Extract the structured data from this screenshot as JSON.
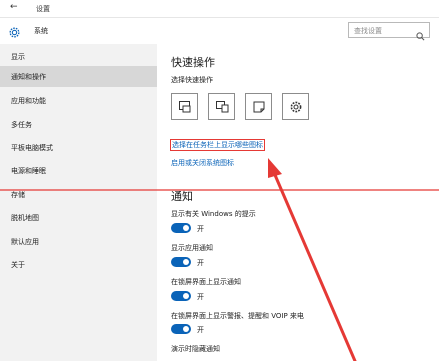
{
  "window": {
    "title": "设置"
  },
  "header": {
    "title": "系统",
    "search_placeholder": "查找设置"
  },
  "sidebar": {
    "items": [
      {
        "label": "显示"
      },
      {
        "label": "通知和操作",
        "active": true
      },
      {
        "label": "应用和功能"
      },
      {
        "label": "多任务"
      },
      {
        "label": "平板电脑模式"
      },
      {
        "label": "电源和睡眠"
      },
      {
        "label": "存储"
      },
      {
        "label": "脱机地图"
      },
      {
        "label": "默认应用"
      },
      {
        "label": "关于"
      }
    ]
  },
  "main": {
    "quick_actions": {
      "title": "快速操作",
      "subtitle": "选择快速操作",
      "tiles": [
        {
          "icon": "tablet-mode-icon"
        },
        {
          "icon": "connect-icon"
        },
        {
          "icon": "note-icon"
        },
        {
          "icon": "settings-gear-icon"
        }
      ],
      "link_taskbar_icons": "选择在任务栏上显示哪些图标",
      "link_system_icons": "启用或关闭系统图标"
    },
    "notifications": {
      "title": "通知",
      "settings": [
        {
          "label": "显示有关 Windows 的提示",
          "state": "开"
        },
        {
          "label": "显示应用通知",
          "state": "开"
        },
        {
          "label": "在锁屏界面上显示通知",
          "state": "开"
        },
        {
          "label": "在锁屏界面上显示警报、提醒和 VOIP 来电",
          "state": "开"
        },
        {
          "label": "演示时隐藏通知",
          "state": ""
        }
      ]
    }
  },
  "colors": {
    "accent": "#0a63b8",
    "sidebar_bg": "#f2f2f2",
    "sidebar_active": "#d7d7d7",
    "annotation_red": "#e53935"
  }
}
